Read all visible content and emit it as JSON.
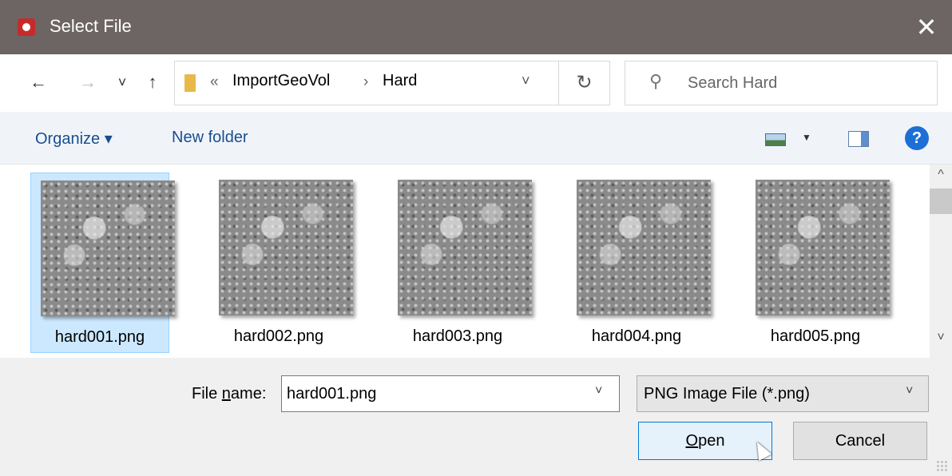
{
  "window": {
    "title": "Select File",
    "close_glyph": "✕"
  },
  "nav": {
    "back_glyph": "←",
    "forward_glyph": "→",
    "recent_glyph": "˅",
    "up_glyph": "↑",
    "breadcrumb": {
      "overflow_glyph": "«",
      "items": [
        "ImportGeoVol",
        "Hard"
      ],
      "separator": "›"
    },
    "address_dropdown_glyph": "˅",
    "refresh_glyph": "↻"
  },
  "search": {
    "placeholder": "Search Hard",
    "icon": "⚲"
  },
  "toolbar": {
    "organize_label": "Organize ▾",
    "new_folder_label": "New folder",
    "view_caret": "▼",
    "help_label": "?"
  },
  "files": [
    {
      "name": "hard001.png",
      "selected": true
    },
    {
      "name": "hard002.png",
      "selected": false
    },
    {
      "name": "hard003.png",
      "selected": false
    },
    {
      "name": "hard004.png",
      "selected": false
    },
    {
      "name": "hard005.png",
      "selected": false
    }
  ],
  "scroll": {
    "up_glyph": "^",
    "down_glyph": "˅"
  },
  "bottom": {
    "filename_label_pre": "File ",
    "filename_label_underlined": "n",
    "filename_label_post": "ame:",
    "filename_value": "hard001.png",
    "filetype_value": "PNG Image File (*.png)",
    "dropdown_glyph": "˅",
    "open_label_underlined": "O",
    "open_label_rest": "pen",
    "cancel_label": "Cancel"
  },
  "colors": {
    "titlebar": "#6d6563",
    "accent": "#0078d7",
    "selection": "#cce8ff",
    "command_bar": "#f0f4f9"
  },
  "icons": [
    "app-icon",
    "close-icon",
    "back-icon",
    "forward-icon",
    "recent-locations-icon",
    "up-icon",
    "folder-icon",
    "refresh-icon",
    "search-icon",
    "view-icon",
    "preview-pane-icon",
    "help-icon"
  ]
}
